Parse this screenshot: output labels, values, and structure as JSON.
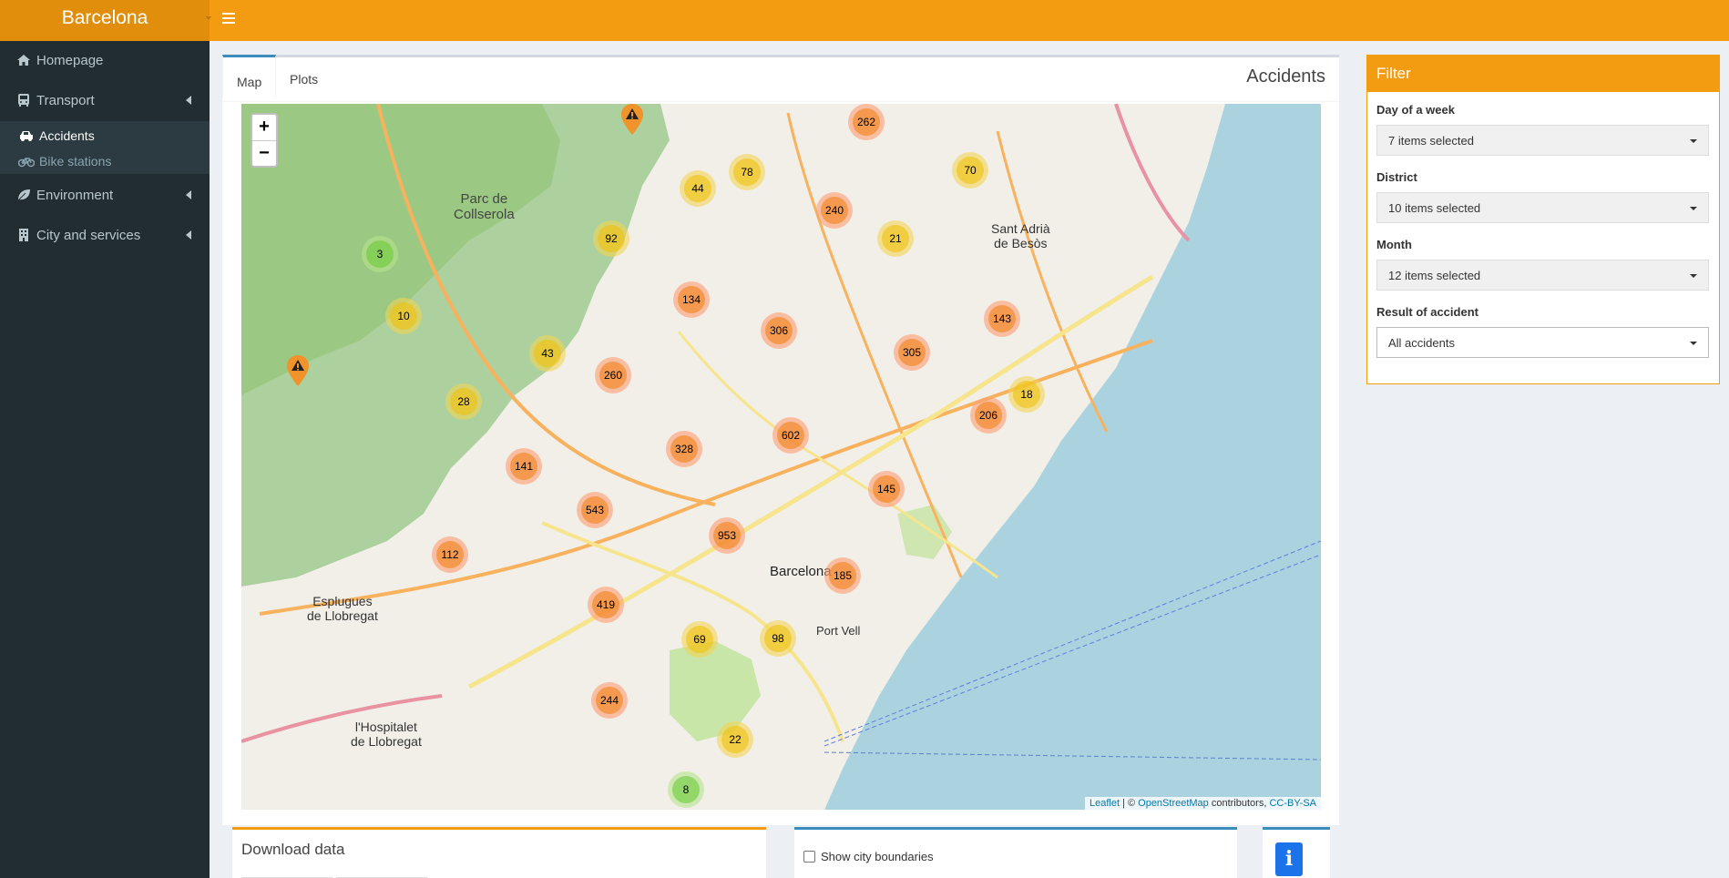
{
  "header": {
    "title": "Barcelona"
  },
  "sidebar": {
    "items": [
      {
        "label": "Homepage",
        "icon": "home-icon"
      },
      {
        "label": "Transport",
        "icon": "bus-icon"
      },
      {
        "label": "Environment",
        "icon": "leaf-icon"
      },
      {
        "label": "City and services",
        "icon": "building-icon"
      }
    ],
    "transport_submenu": [
      {
        "label": "Accidents",
        "icon": "car-crash-icon",
        "active": true
      },
      {
        "label": "Bike stations",
        "icon": "bicycle-icon",
        "active": false
      }
    ]
  },
  "main": {
    "tabs": [
      {
        "label": "Map",
        "active": true
      },
      {
        "label": "Plots",
        "active": false
      }
    ],
    "title": "Accidents"
  },
  "map": {
    "zoom_in": "+",
    "zoom_out": "−",
    "attribution": {
      "leaflet": "Leaflet",
      "sep": " | © ",
      "osm": "OpenStreetMap",
      "contributors": " contributors, ",
      "license": "CC-BY-SA"
    },
    "labels": {
      "parc": "Parc de\nCollserola",
      "barcelona": "Barcelona",
      "sant_adria": "Sant Adrià\nde Besòs",
      "esplugues": "Esplugues\nde Llobregat",
      "hospitalet": "l'Hospitalet\nde Llobregat",
      "port_vell": "Port Vell"
    },
    "clusters": [
      {
        "count": "262",
        "level": "large"
      },
      {
        "count": "78",
        "level": "medium"
      },
      {
        "count": "70",
        "level": "medium"
      },
      {
        "count": "44",
        "level": "medium"
      },
      {
        "count": "240",
        "level": "large"
      },
      {
        "count": "21",
        "level": "medium"
      },
      {
        "count": "92",
        "level": "medium"
      },
      {
        "count": "3",
        "level": "small"
      },
      {
        "count": "134",
        "level": "large"
      },
      {
        "count": "10",
        "level": "medium"
      },
      {
        "count": "306",
        "level": "large"
      },
      {
        "count": "143",
        "level": "large"
      },
      {
        "count": "305",
        "level": "large"
      },
      {
        "count": "43",
        "level": "medium"
      },
      {
        "count": "260",
        "level": "large"
      },
      {
        "count": "28",
        "level": "medium"
      },
      {
        "count": "18",
        "level": "medium"
      },
      {
        "count": "206",
        "level": "large"
      },
      {
        "count": "602",
        "level": "large"
      },
      {
        "count": "328",
        "level": "large"
      },
      {
        "count": "141",
        "level": "large"
      },
      {
        "count": "145",
        "level": "large"
      },
      {
        "count": "543",
        "level": "large"
      },
      {
        "count": "953",
        "level": "large"
      },
      {
        "count": "112",
        "level": "large"
      },
      {
        "count": "185",
        "level": "large"
      },
      {
        "count": "419",
        "level": "large"
      },
      {
        "count": "69",
        "level": "medium"
      },
      {
        "count": "98",
        "level": "medium"
      },
      {
        "count": "244",
        "level": "large"
      },
      {
        "count": "22",
        "level": "medium"
      },
      {
        "count": "8",
        "level": "small"
      }
    ]
  },
  "filter": {
    "title": "Filter",
    "fields": [
      {
        "label": "Day of a week",
        "value": "7 items selected"
      },
      {
        "label": "District",
        "value": "10 items selected"
      },
      {
        "label": "Month",
        "value": "12 items selected"
      },
      {
        "label": "Result of accident",
        "value": "All accidents"
      }
    ]
  },
  "bottom": {
    "download_title": "Download data",
    "show_boundaries": "Show city boundaries",
    "info": "i"
  },
  "colors": {
    "accent": "#f39c12",
    "sidebar": "#222d32",
    "tab_active": "#3c8dbc"
  }
}
